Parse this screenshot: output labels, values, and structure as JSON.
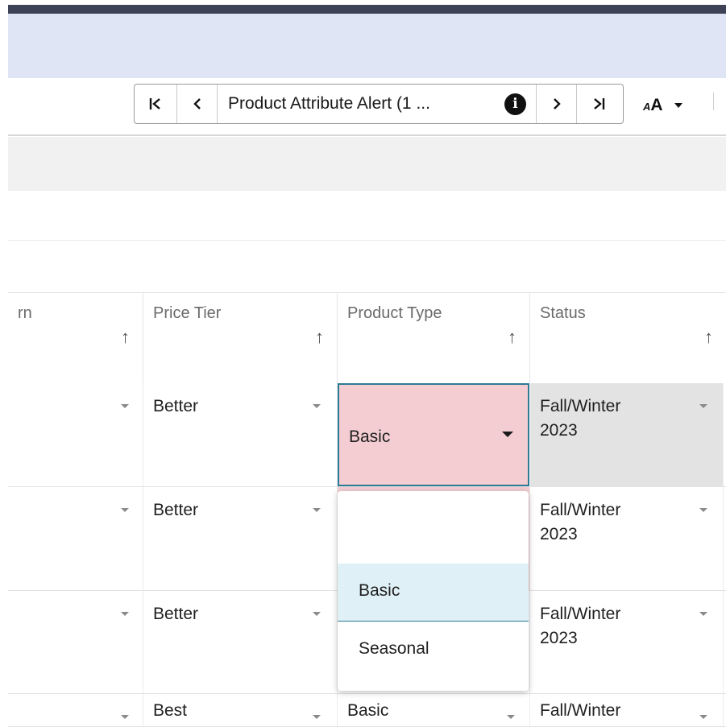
{
  "toolbar": {
    "first_icon": "first-record-icon",
    "prev_icon": "previous-record-icon",
    "record_label": "Product Attribute Alert (1 ...",
    "info_icon": "info-icon",
    "next_icon": "next-record-icon",
    "last_icon": "last-record-icon",
    "font_size_label": "A",
    "font_size_small": "A"
  },
  "columns": [
    {
      "label": "rn",
      "sort": "↑"
    },
    {
      "label": "Price Tier",
      "sort": "↑"
    },
    {
      "label": "Product Type",
      "sort": "↑"
    },
    {
      "label": "Status",
      "sort": "↑"
    }
  ],
  "rows": [
    {
      "price_tier": "Better",
      "product_type": "Basic",
      "status_line1": "Fall/Winter",
      "status_line2": "2023"
    },
    {
      "price_tier": "Better",
      "product_type": "",
      "status_line1": "Fall/Winter",
      "status_line2": "2023"
    },
    {
      "price_tier": "Better",
      "product_type": "",
      "status_line1": "Fall/Winter",
      "status_line2": "2023"
    },
    {
      "price_tier": "Best",
      "product_type": "Basic",
      "status_line1": "Fall/Winter",
      "status_line2": ""
    }
  ],
  "dropdown": {
    "options": [
      "Basic",
      "Seasonal"
    ],
    "selected": "Basic"
  },
  "colors": {
    "banner": "#dfe5f5",
    "alert_cell": "#f3cdd2",
    "focus_border": "#2c7a93",
    "selected_option": "#dff0f6"
  }
}
